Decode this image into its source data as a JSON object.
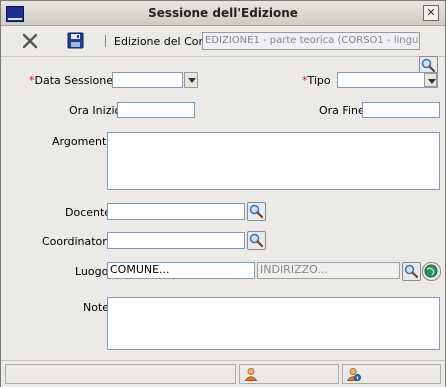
{
  "window": {
    "title": "Sessione dell'Edizione"
  },
  "toolbar": {
    "cancel_icon": "close-x-icon",
    "save_icon": "floppy-disk-icon",
    "edition_label": "Edizione del Corso",
    "edition_value": "EDIZIONE1 - parte teorica (CORSO1 - lingu"
  },
  "form": {
    "data_sessione_label": "Data Sessione",
    "required_mark": "*",
    "tipo_label": "Tipo",
    "ora_inizio_label": "Ora Inizio",
    "ora_fine_label": "Ora Fine",
    "argomento_label": "Argomento",
    "docente_label": "Docente",
    "coordinatore_label": "Coordinatore",
    "luogo_label": "Luogo",
    "luogo_comune_value": "COMUNE...",
    "luogo_indirizzo_value": "INDIRIZZO...",
    "note_label": "Note"
  },
  "colors": {
    "required": "#d01010",
    "input_border": "#7f9db9",
    "title_bg": "#dcdad2"
  }
}
